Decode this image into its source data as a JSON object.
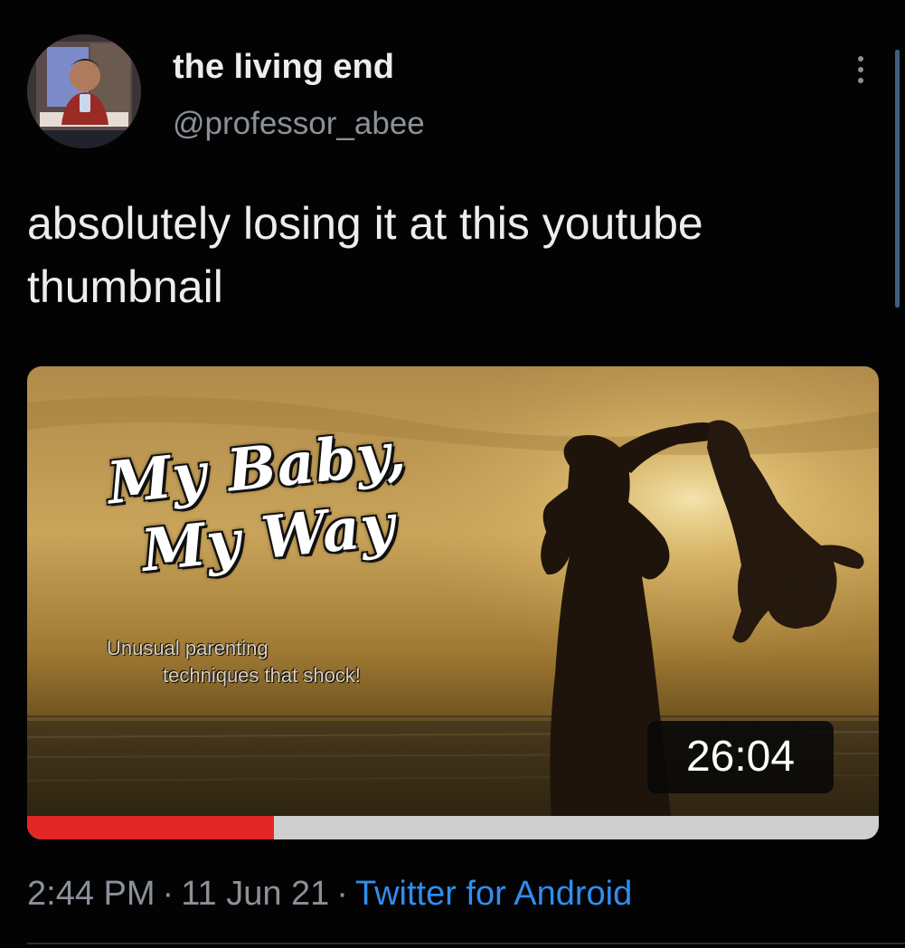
{
  "author": {
    "display_name": "the living end",
    "handle": "@professor_abee"
  },
  "tweet": {
    "text": "absolutely losing it at this youtube thumbnail"
  },
  "media": {
    "video_title_line1": "My Baby,",
    "video_title_line2": "My Way",
    "video_subtitle_line1": "Unusual parenting",
    "video_subtitle_line2": "techniques that shock!",
    "duration": "26:04",
    "progress_fraction": 0.29
  },
  "meta": {
    "time": "2:44 PM",
    "separator": "·",
    "date": "11 Jun 21",
    "source": "Twitter for Android"
  },
  "icons": {
    "more": "more-vertical-icon"
  },
  "colors": {
    "background": "#030304",
    "primary_text": "#ecedef",
    "secondary_text": "#8b9198",
    "link": "#2f8ef0",
    "progress": "#e32626"
  }
}
